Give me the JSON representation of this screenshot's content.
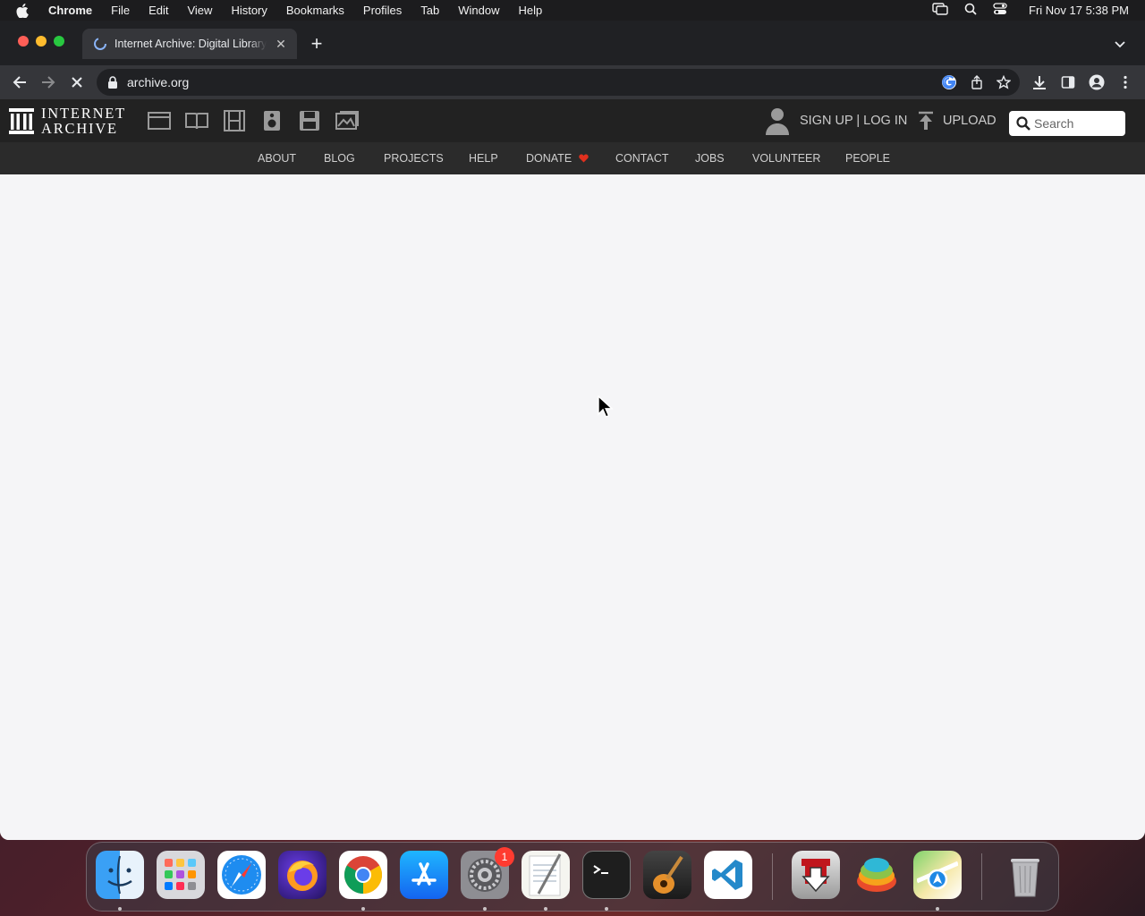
{
  "menubar": {
    "app_name": "Chrome",
    "items": [
      "File",
      "Edit",
      "View",
      "History",
      "Bookmarks",
      "Profiles",
      "Tab",
      "Window",
      "Help"
    ],
    "clock": "Fri Nov 17  5:38 PM"
  },
  "browser": {
    "tab_title": "Internet Archive: Digital Library of Free & Borrowable Books",
    "url": "archive.org"
  },
  "ia": {
    "logo_line1": "INTERNET",
    "logo_line2": "ARCHIVE",
    "media_icons": [
      "web-icon",
      "texts-icon",
      "video-icon",
      "audio-icon",
      "software-icon",
      "images-icon"
    ],
    "auth_label": "SIGN UP | LOG IN",
    "upload_label": "UPLOAD",
    "search_placeholder": "Search",
    "nav": [
      "ABOUT",
      "BLOG",
      "PROJECTS",
      "HELP",
      "DONATE",
      "CONTACT",
      "JOBS",
      "VOLUNTEER",
      "PEOPLE"
    ],
    "donate_heart_color": "#e0301e"
  },
  "dock": {
    "apps": [
      "Finder",
      "Launchpad",
      "Safari",
      "Firefox",
      "Google Chrome",
      "App Store",
      "System Settings",
      "TextEdit",
      "Terminal",
      "GarageBand",
      "Visual Studio Code",
      "Downie",
      "Pastel",
      "Maps",
      "Trash"
    ],
    "settings_badge": "1"
  },
  "colors": {
    "ia_header_bg": "#222222",
    "ia_nav_bg": "#2b2b2b",
    "loading_bar": "#1e88e5"
  }
}
